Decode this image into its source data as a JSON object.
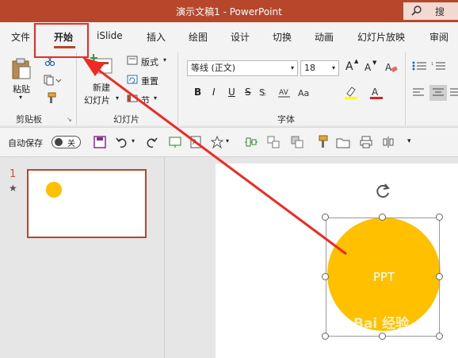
{
  "titlebar": {
    "title": "演示文稿1  -  PowerPoint",
    "search_label": "搜"
  },
  "tabs": [
    "文件",
    "开始",
    "iSlide",
    "插入",
    "绘图",
    "设计",
    "切换",
    "动画",
    "幻灯片放映",
    "审阅"
  ],
  "ribbon": {
    "clipboard": {
      "paste": "粘贴",
      "group": "剪贴板"
    },
    "slides": {
      "new_slide_l1": "新建",
      "new_slide_l2": "幻灯片",
      "layout": "版式",
      "reset": "重置",
      "section": "节",
      "group": "幻灯片"
    },
    "font": {
      "font_name": "等线 (正文)",
      "font_size": "18",
      "grow": "A",
      "shrink": "A",
      "bold": "B",
      "italic": "I",
      "underline": "U",
      "strike": "S",
      "group": "字体"
    }
  },
  "qat": {
    "autosave": "自动保存",
    "autosave_state": "关"
  },
  "slides_panel": {
    "number": "1",
    "star": "★"
  },
  "slide": {
    "shape_text": "PPT"
  },
  "watermark": "Bai 经验",
  "colors": {
    "accent": "#b7472a",
    "shape_fill": "#ffc000",
    "annotation": "#ee2a24"
  }
}
